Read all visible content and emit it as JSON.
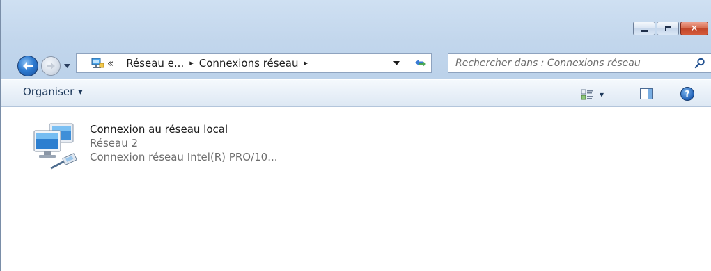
{
  "window": {
    "caption_buttons": {
      "minimize": "minimize-icon",
      "maximize": "maximize-icon",
      "close": "close-icon"
    }
  },
  "navigation": {
    "back_icon": "back-arrow-icon",
    "forward_icon": "forward-arrow-icon",
    "breadcrumb": {
      "overflow": "«",
      "items": [
        "Réseau e...",
        "Connexions réseau"
      ],
      "separator": "▸"
    },
    "search": {
      "placeholder": "Rechercher dans : Connexions réseau",
      "value": ""
    }
  },
  "command_bar": {
    "organize_label": "Organiser",
    "organize_arrow": "▾",
    "views_arrow": "▾",
    "help_glyph": "?"
  },
  "items": [
    {
      "title": "Connexion au réseau local",
      "network": "Réseau  2",
      "device": "Connexion réseau Intel(R) PRO/10..."
    }
  ],
  "colors": {
    "chrome_blue": "#c2d6ec",
    "close_red": "#c2472a",
    "link_dark": "#1e395b",
    "secondary_text": "#6d6d6d"
  }
}
